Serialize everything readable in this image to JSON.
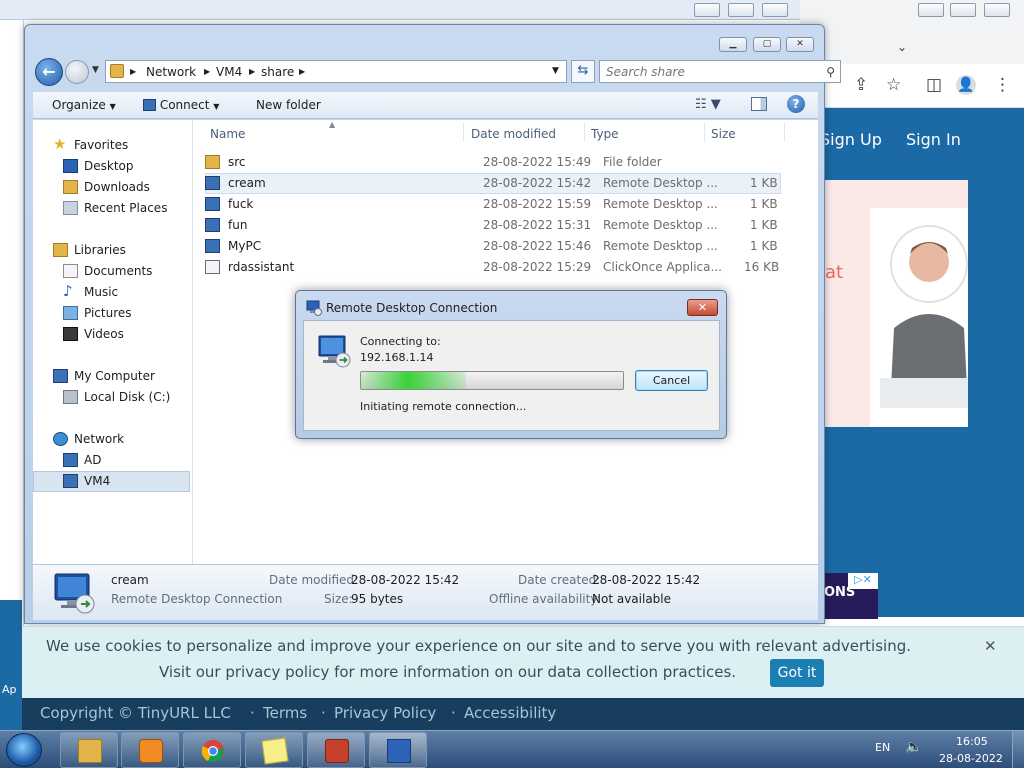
{
  "explorer": {
    "breadcrumb": [
      "Network",
      "VM4",
      "share"
    ],
    "search_placeholder": "Search share",
    "toolbar": {
      "organize": "Organize",
      "connect": "Connect",
      "new_folder": "New folder"
    },
    "nav": {
      "favorites": "Favorites",
      "desktop": "Desktop",
      "downloads": "Downloads",
      "recent_places": "Recent Places",
      "libraries": "Libraries",
      "documents": "Documents",
      "music": "Music",
      "pictures": "Pictures",
      "videos": "Videos",
      "my_computer": "My Computer",
      "local_disk": "Local Disk (C:)",
      "network": "Network",
      "ad": "AD",
      "vm4": "VM4"
    },
    "columns": {
      "name": "Name",
      "date_modified": "Date modified",
      "type": "Type",
      "size": "Size"
    },
    "files": [
      {
        "name": "src",
        "date": "28-08-2022 15:49",
        "type": "File folder",
        "size": "",
        "icon": "folder-icon"
      },
      {
        "name": "cream",
        "date": "28-08-2022 15:42",
        "type": "Remote Desktop ...",
        "size": "1 KB",
        "icon": "rdp-file-icon"
      },
      {
        "name": "fuck",
        "date": "28-08-2022 15:59",
        "type": "Remote Desktop ...",
        "size": "1 KB",
        "icon": "rdp-file-icon"
      },
      {
        "name": "fun",
        "date": "28-08-2022 15:31",
        "type": "Remote Desktop ...",
        "size": "1 KB",
        "icon": "rdp-file-icon"
      },
      {
        "name": "MyPC",
        "date": "28-08-2022 15:46",
        "type": "Remote Desktop ...",
        "size": "1 KB",
        "icon": "rdp-file-icon"
      },
      {
        "name": "rdassistant",
        "date": "28-08-2022 15:29",
        "type": "ClickOnce Applica...",
        "size": "16 KB",
        "icon": "application-icon"
      }
    ],
    "details": {
      "name": "cream",
      "type": "Remote Desktop Connection",
      "date_modified_label": "Date modified:",
      "date_modified": "28-08-2022 15:42",
      "size_label": "Size:",
      "size": "95 bytes",
      "date_created_label": "Date created:",
      "date_created": "28-08-2022 15:42",
      "offline_label": "Offline availability:",
      "offline": "Not available"
    }
  },
  "rdc_dialog": {
    "title": "Remote Desktop Connection",
    "connecting_label": "Connecting to:",
    "address": "192.168.1.14",
    "progress_indeterminate": true,
    "cancel_label": "Cancel",
    "status": "Initiating remote connection..."
  },
  "website": {
    "sign_up": "Sign Up",
    "sign_in": "Sign In",
    "hero_fragment": "at",
    "ad_fragment": "ONS",
    "cookie_line1": "We use cookies to personalize and improve your experience on our site and to serve you with relevant advertising.",
    "cookie_line2": "Visit our privacy policy for more information on our data collection practices.",
    "got_it": "Got it",
    "footer_copyright": "Copyright © TinyURL LLC",
    "footer_terms": "Terms",
    "footer_privacy": "Privacy Policy",
    "footer_accessibility": "Accessibility",
    "left_fragment": "Ap"
  },
  "taskbar": {
    "language": "EN",
    "time": "16:05",
    "date": "28-08-2022",
    "apps": [
      "windows-explorer-icon",
      "media-player-icon",
      "chrome-icon",
      "sticky-notes-icon",
      "remote-desktop-app-icon",
      "remote-desktop-connection-icon"
    ]
  },
  "colors": {
    "site_blue": "#1b6aa5",
    "footer_navy": "#173e5e",
    "cookie_bg": "#dcf0f3",
    "got_it_button": "#1b7fb3",
    "progress_green": "#3ad13a"
  }
}
